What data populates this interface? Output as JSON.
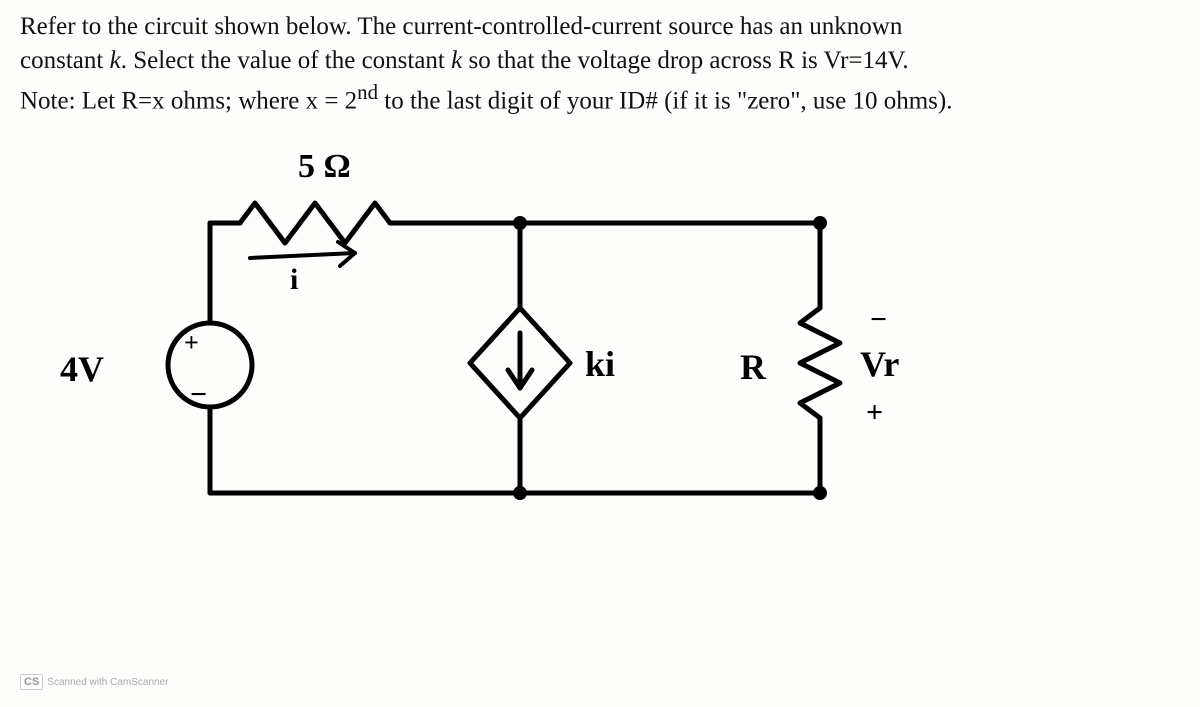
{
  "problem": {
    "line1_prefix": "Refer to the circuit shown below. The current-controlled-current source has an unknown",
    "line2_prefix": "constant ",
    "line2_k": "k",
    "line2_mid": ". Select the value of the constant ",
    "line2_k2": "k",
    "line2_suffix": " so that the voltage drop across R is Vr=14V.",
    "line3_prefix": "Note: Let R=x ohms; where x = 2",
    "line3_sup": "nd",
    "line3_suffix": " to the last digit of your ID# (if it is \"zero\", use 10 ohms)."
  },
  "circuit": {
    "r_top": "5 Ω",
    "current_label": "i",
    "source_plus": "+",
    "source_minus": "−",
    "source_value": "4V",
    "ki_label": "ki",
    "R_label": "R",
    "Vr_label": "Vr",
    "vr_minus": "−",
    "vr_plus": "+"
  },
  "watermark": {
    "cs": "CS",
    "text": "Scanned with CamScanner"
  }
}
